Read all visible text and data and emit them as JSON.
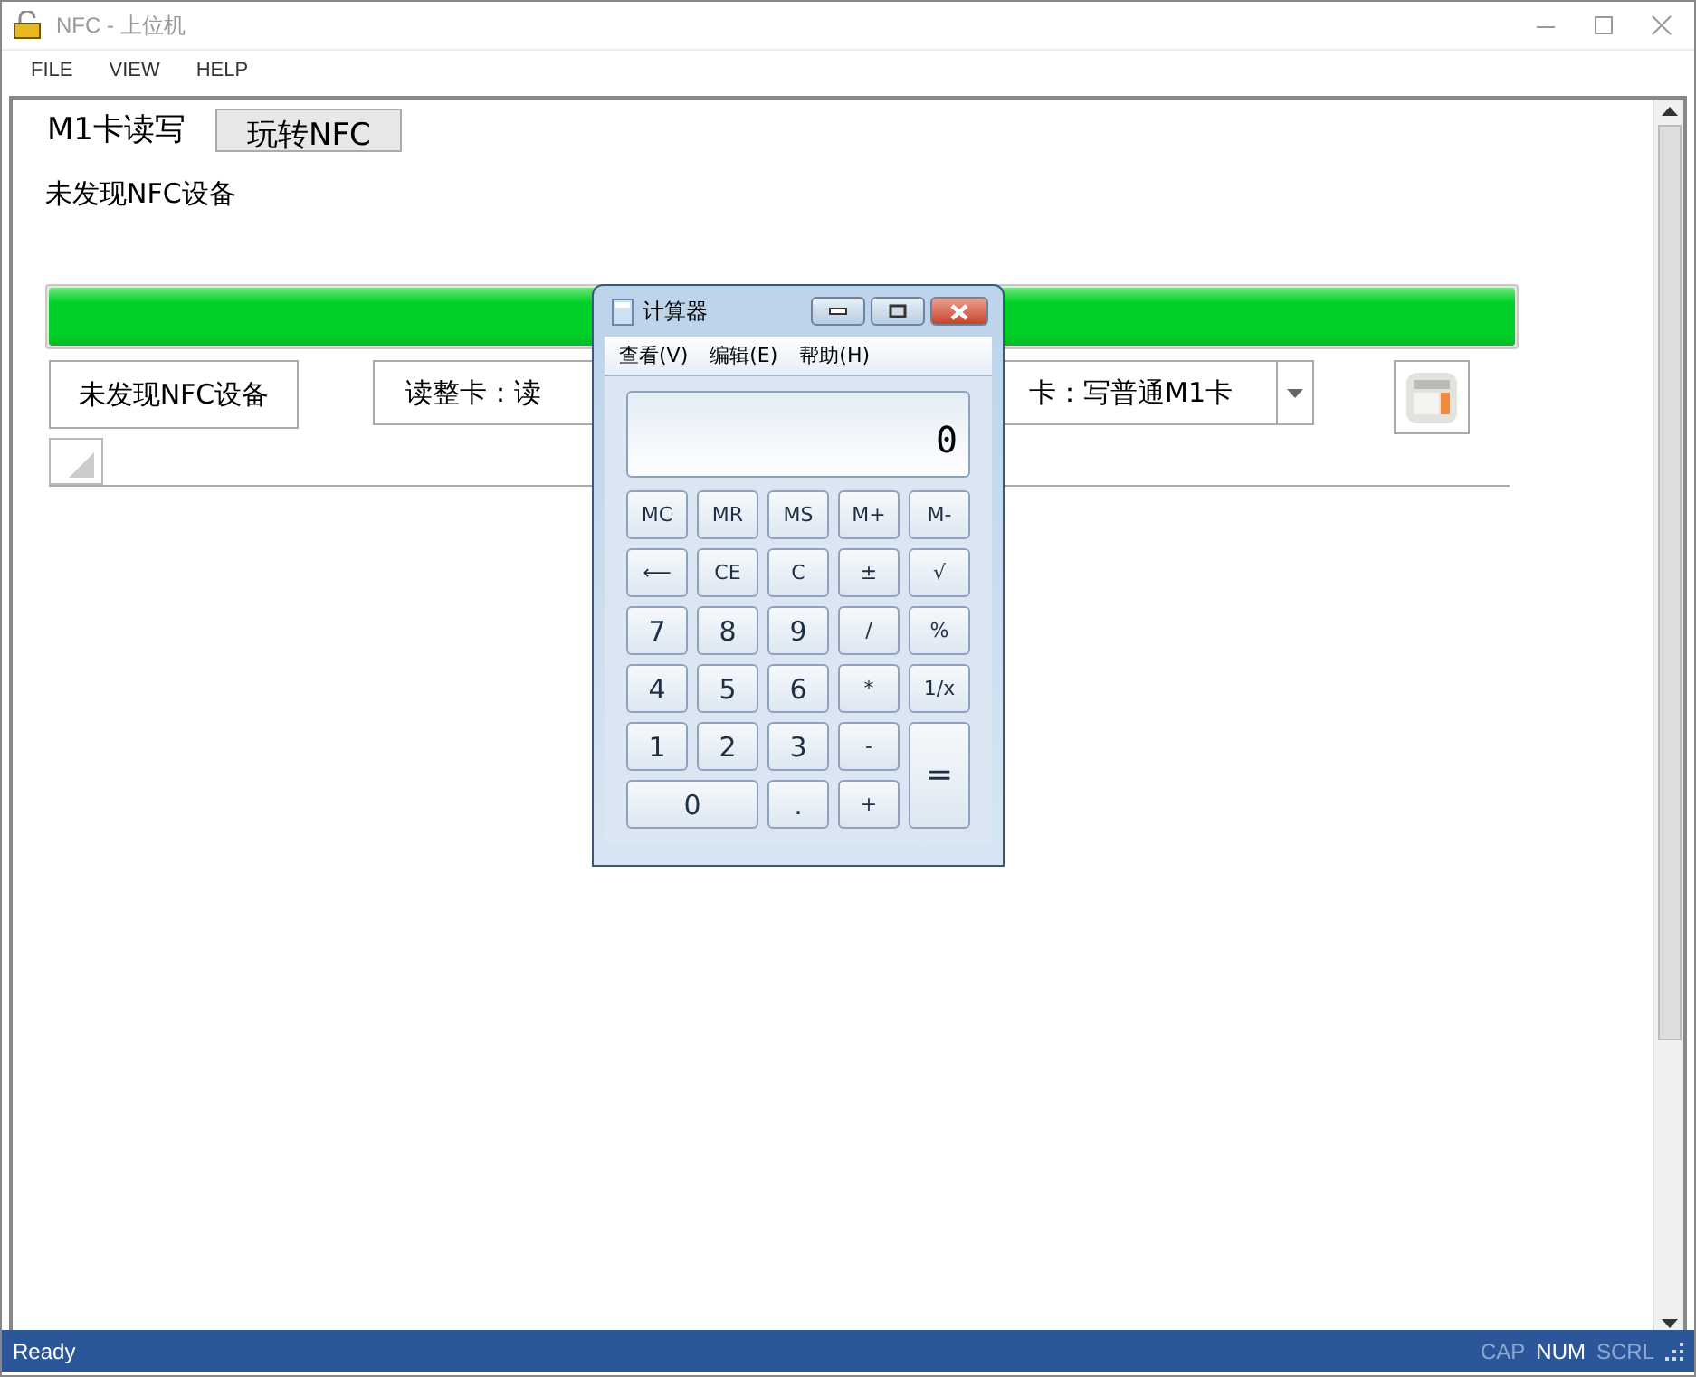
{
  "window": {
    "title": "NFC - 上位机"
  },
  "menu": [
    "FILE",
    "VIEW",
    "HELP"
  ],
  "tabs": [
    {
      "label": "M1卡读写",
      "selected": true
    },
    {
      "label": "玩转NFC",
      "selected": false
    }
  ],
  "status_text": "未发现NFC设备",
  "progress": {
    "level": 1
  },
  "device_button": "未发现NFC设备",
  "mode_select": {
    "value_start": "读整卡：读",
    "value_end": "卡：写普通M1卡"
  },
  "calculator": {
    "title": "计算器",
    "menu": [
      "查看(V)",
      "编辑(E)",
      "帮助(H)"
    ],
    "display": "0",
    "keys": [
      {
        "label": "MC",
        "kind": "mem"
      },
      {
        "label": "MR",
        "kind": "mem"
      },
      {
        "label": "MS",
        "kind": "mem"
      },
      {
        "label": "M+",
        "kind": "mem"
      },
      {
        "label": "M-",
        "kind": "mem"
      },
      {
        "label": "⟵",
        "kind": "op"
      },
      {
        "label": "CE",
        "kind": "op"
      },
      {
        "label": "C",
        "kind": "op"
      },
      {
        "label": "±",
        "kind": "op"
      },
      {
        "label": "√",
        "kind": "op"
      },
      {
        "label": "7",
        "kind": "digit"
      },
      {
        "label": "8",
        "kind": "digit"
      },
      {
        "label": "9",
        "kind": "digit"
      },
      {
        "label": "/",
        "kind": "op"
      },
      {
        "label": "%",
        "kind": "op"
      },
      {
        "label": "4",
        "kind": "digit"
      },
      {
        "label": "5",
        "kind": "digit"
      },
      {
        "label": "6",
        "kind": "digit"
      },
      {
        "label": "*",
        "kind": "op"
      },
      {
        "label": "1/x",
        "kind": "op"
      },
      {
        "label": "1",
        "kind": "digit"
      },
      {
        "label": "2",
        "kind": "digit"
      },
      {
        "label": "3",
        "kind": "digit"
      },
      {
        "label": "-",
        "kind": "op"
      },
      {
        "label": "=",
        "kind": "tall"
      },
      {
        "label": "0",
        "kind": "wide"
      },
      {
        "label": ".",
        "kind": "digit"
      },
      {
        "label": "+",
        "kind": "op"
      }
    ]
  },
  "status_bar": {
    "text": "Ready",
    "indicators": [
      {
        "label": "CAP",
        "on": false
      },
      {
        "label": "NUM",
        "on": true
      },
      {
        "label": "SCRL",
        "on": false
      }
    ]
  }
}
